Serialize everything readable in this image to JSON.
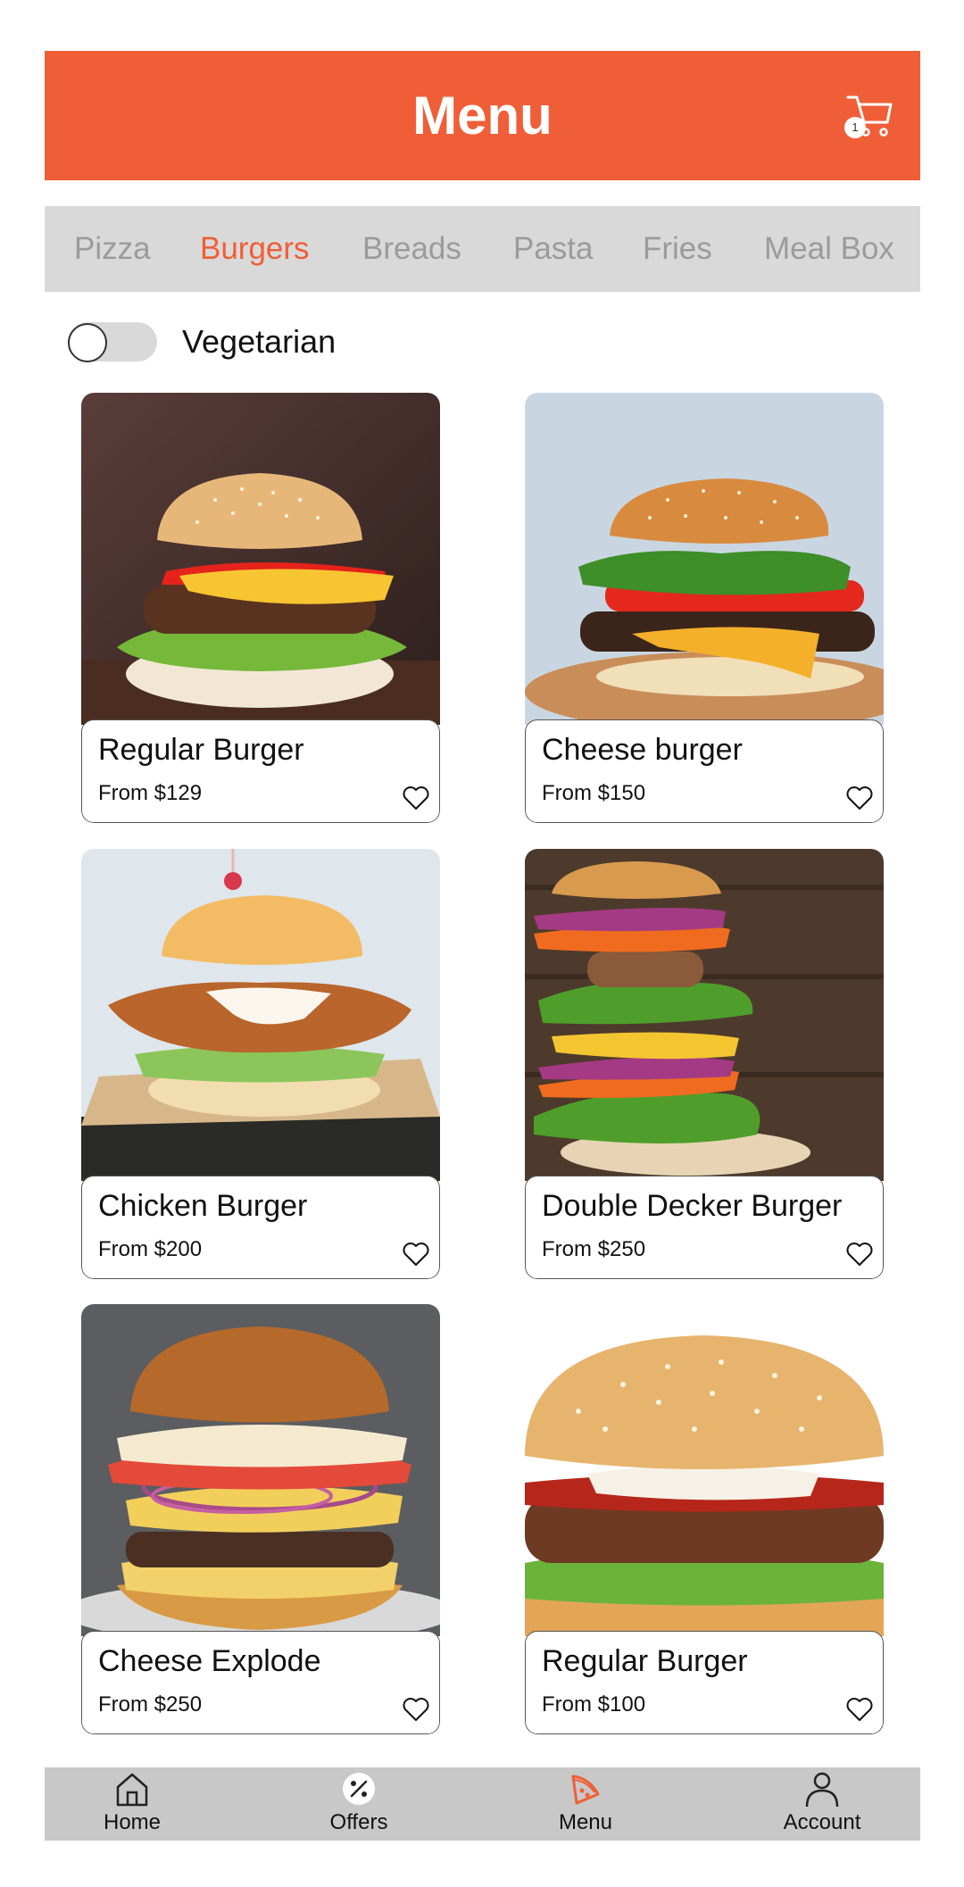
{
  "header": {
    "title": "Menu",
    "cart_count": "1"
  },
  "tabs": [
    {
      "label": "Pizza"
    },
    {
      "label": "Burgers"
    },
    {
      "label": "Breads"
    },
    {
      "label": "Pasta"
    },
    {
      "label": "Fries"
    },
    {
      "label": "Meal Box"
    }
  ],
  "active_tab": "Burgers",
  "filter": {
    "label": "Vegetarian",
    "enabled": false
  },
  "items": [
    {
      "name": "Regular Burger",
      "price": "From $129"
    },
    {
      "name": "Cheese burger",
      "price": "From $150"
    },
    {
      "name": "Chicken Burger",
      "price": "From $200"
    },
    {
      "name": "Double Decker Burger",
      "price": "From $250"
    },
    {
      "name": "Cheese Explode",
      "price": "From $250"
    },
    {
      "name": "Regular Burger",
      "price": "From $100"
    }
  ],
  "nav": [
    {
      "label": "Home",
      "icon": "home-icon"
    },
    {
      "label": "Offers",
      "icon": "percent-icon"
    },
    {
      "label": "Menu",
      "icon": "pizza-slice-icon"
    },
    {
      "label": "Account",
      "icon": "user-icon"
    }
  ],
  "colors": {
    "accent": "#F05E37",
    "tab_bar": "#D9D9D9",
    "nav_bar": "#C8C8C8"
  }
}
